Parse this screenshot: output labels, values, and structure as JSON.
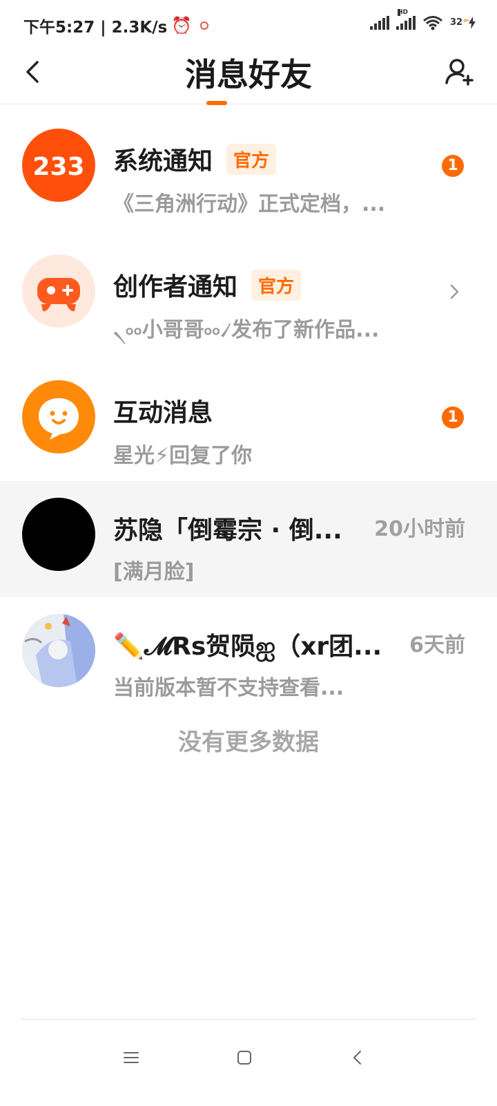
{
  "status_bar": {
    "time_speed": "下午5:27 | 2.3K/s",
    "hd_label": "HD",
    "battery": "32"
  },
  "header": {
    "tab_messages": "消息",
    "tab_friends": "好友"
  },
  "colors": {
    "accent": "#ff6a00",
    "official_bg": "#fff0e2",
    "muted_text": "#9b9b9b"
  },
  "messages": [
    {
      "avatar_text": "233",
      "title": "系统通知",
      "badge": "官方",
      "subtitle": "《三角洲行动》正式定档，...",
      "count": "1",
      "icon": "logo-233-icon"
    },
    {
      "title": "创作者通知",
      "badge": "官方",
      "subtitle": "৲৹৹小哥哥৹৹৴发布了新作品...",
      "icon": "gamepad-icon"
    },
    {
      "title": "互动消息",
      "subtitle": "星光⚡回复了你",
      "count": "1",
      "icon": "chat-bubble-icon"
    },
    {
      "title": "苏隐「倒霉宗 · 倒...",
      "subtitle": "[满月脸]",
      "time": "20小时前"
    },
    {
      "title": "✏️𝓜Rs贺陨ஐ（xr团...",
      "subtitle": "当前版本暂不支持查看...",
      "time": "6天前"
    }
  ],
  "footer": {
    "no_more": "没有更多数据"
  }
}
